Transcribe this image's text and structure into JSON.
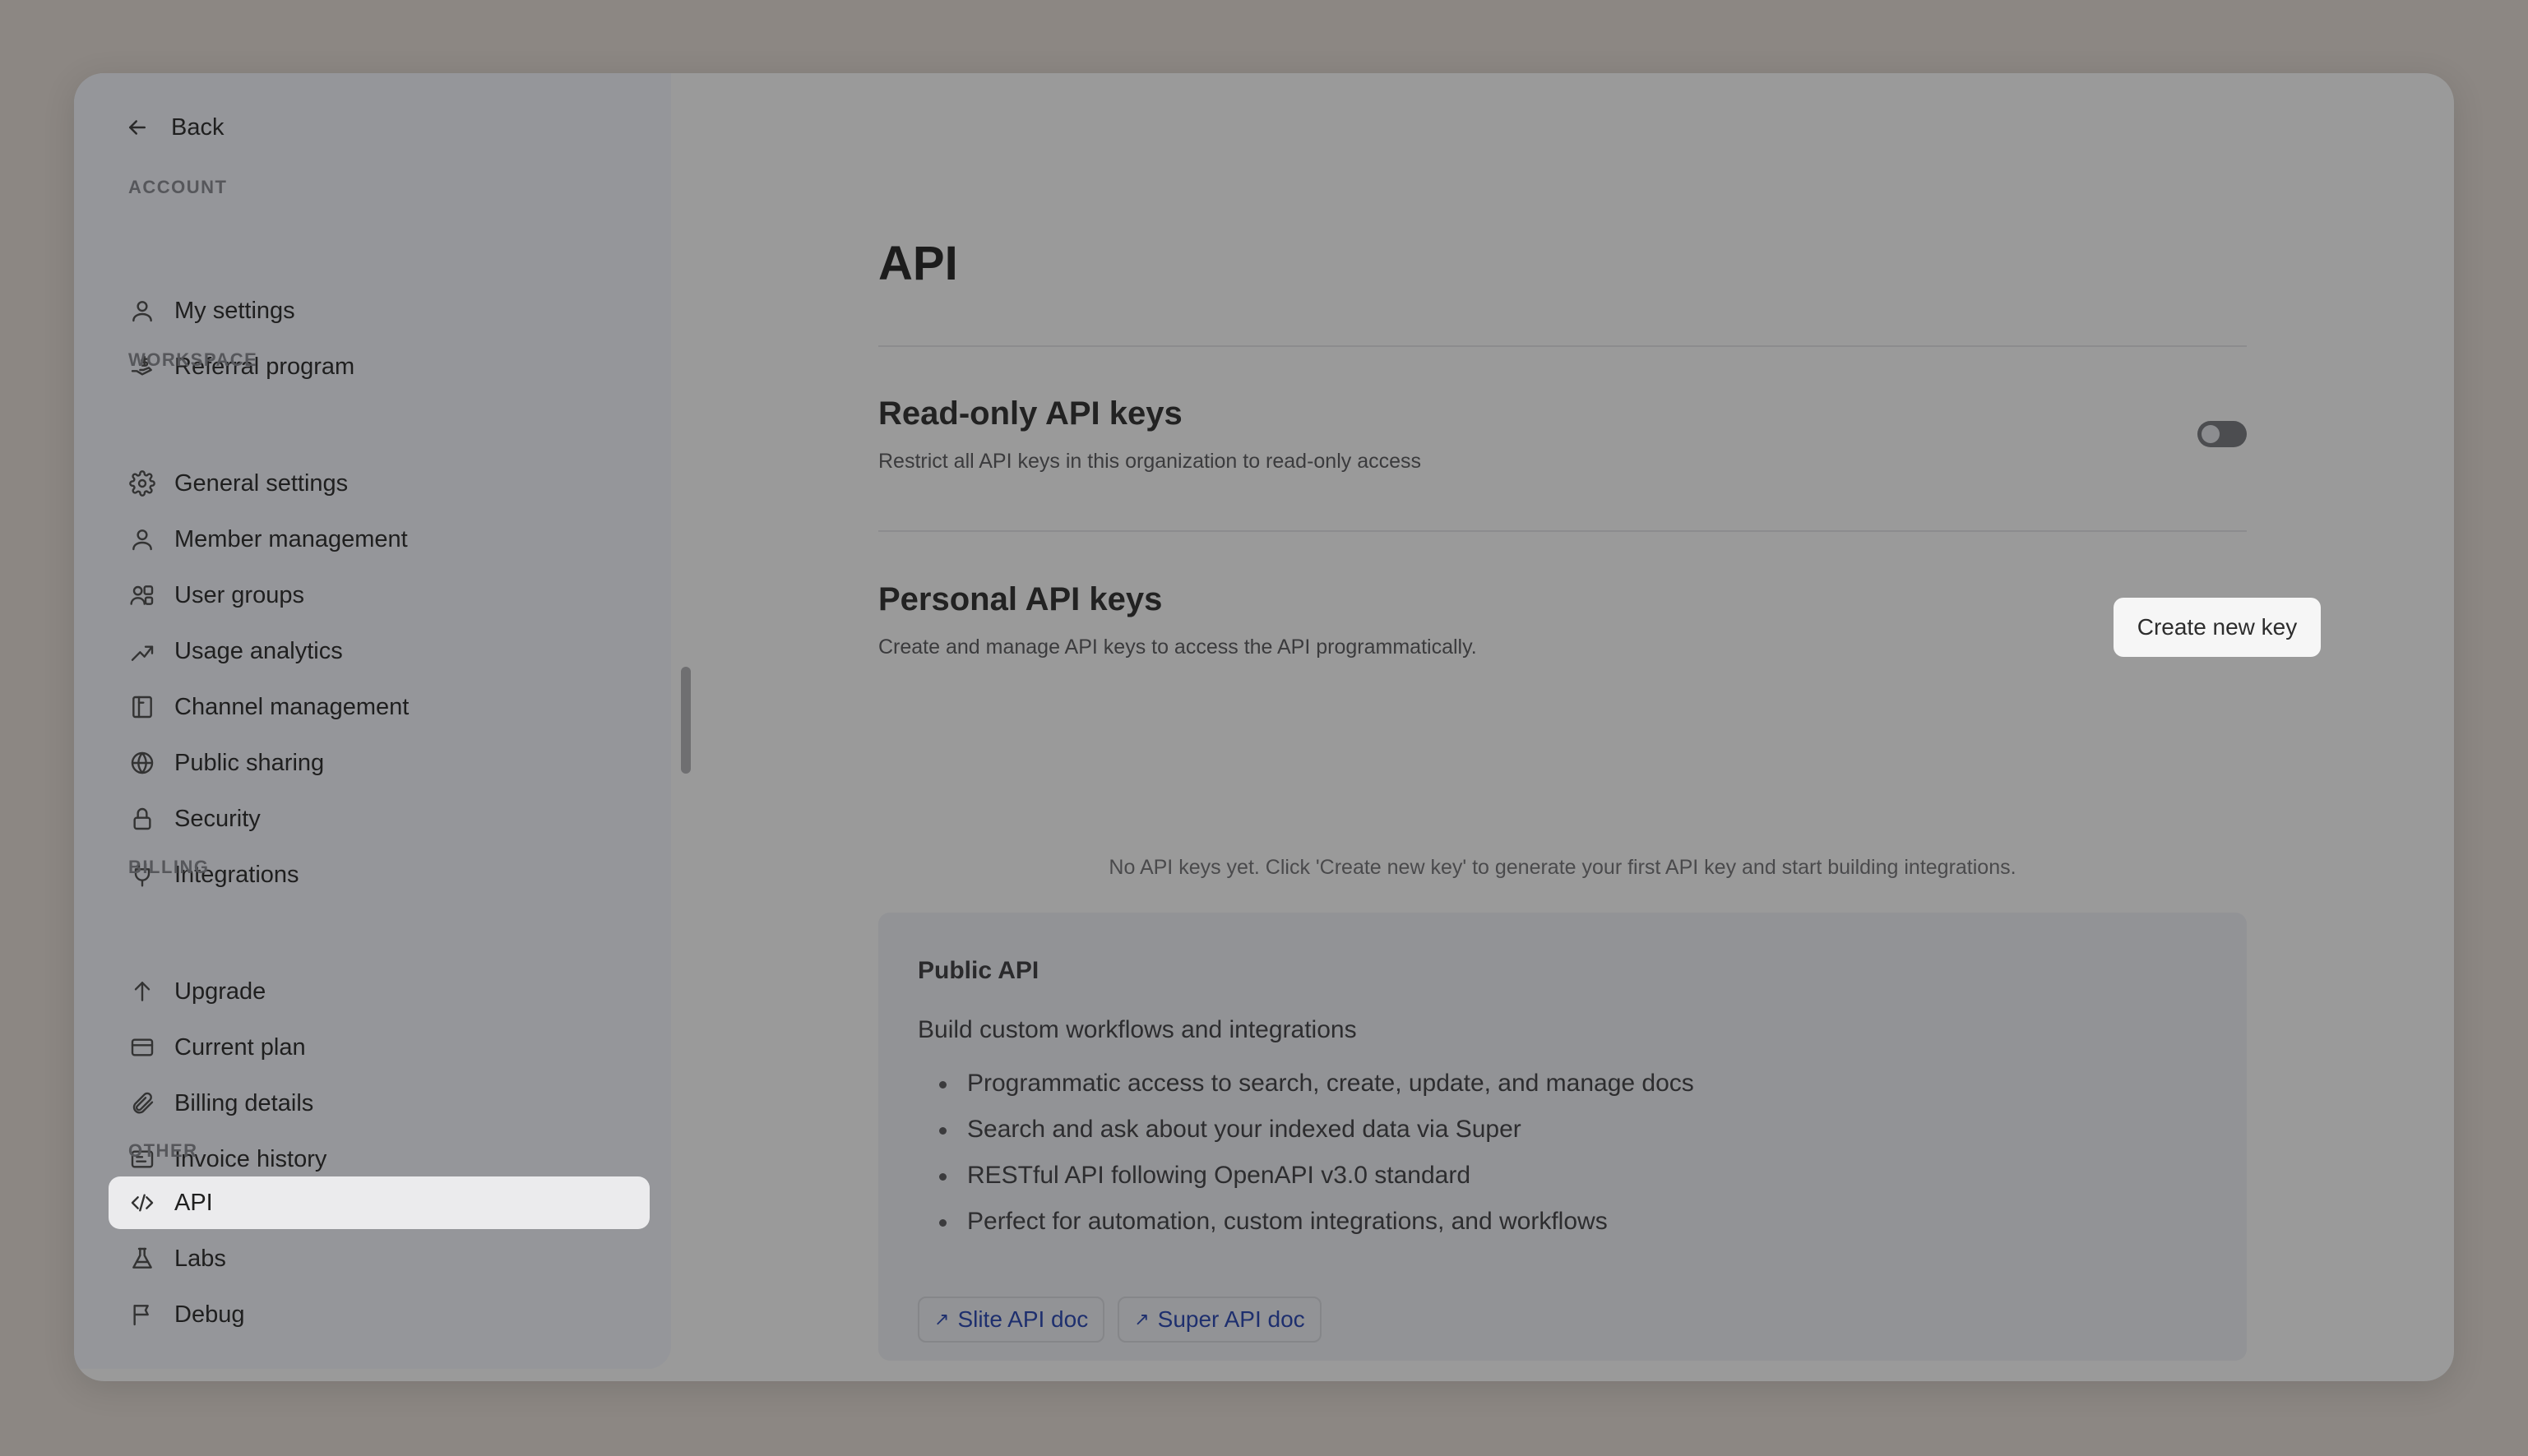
{
  "sidebar": {
    "back_label": "Back",
    "sections": {
      "account": "ACCOUNT",
      "workspace": "WORKSPACE",
      "billing": "BILLING",
      "other": "OTHER"
    },
    "items": [
      {
        "label": "My settings",
        "icon": "user-icon"
      },
      {
        "label": "Referral program",
        "icon": "hand-dollar-icon"
      },
      {
        "label": "General settings",
        "icon": "gear-icon"
      },
      {
        "label": "Member management",
        "icon": "user-icon"
      },
      {
        "label": "User groups",
        "icon": "users-icon"
      },
      {
        "label": "Usage analytics",
        "icon": "trending-up-icon"
      },
      {
        "label": "Channel management",
        "icon": "layout-icon"
      },
      {
        "label": "Public sharing",
        "icon": "globe-icon"
      },
      {
        "label": "Security",
        "icon": "lock-icon"
      },
      {
        "label": "Integrations",
        "icon": "plug-icon"
      },
      {
        "label": "Upgrade",
        "icon": "arrow-up-icon"
      },
      {
        "label": "Current plan",
        "icon": "credit-card-icon"
      },
      {
        "label": "Billing details",
        "icon": "paperclip-icon"
      },
      {
        "label": "Invoice history",
        "icon": "receipt-icon"
      },
      {
        "label": "API",
        "icon": "code-icon",
        "active": true
      },
      {
        "label": "Labs",
        "icon": "flask-icon"
      },
      {
        "label": "Debug",
        "icon": "flag-icon"
      }
    ]
  },
  "main": {
    "title": "API",
    "readonly": {
      "title": "Read-only API keys",
      "description": "Restrict all API keys in this organization to read-only access",
      "enabled": false
    },
    "personal": {
      "title": "Personal API keys",
      "description": "Create and manage API keys to access the API programmatically.",
      "create_button": "Create new key",
      "empty_message": "No API keys yet. Click 'Create new key' to generate your first API key and start building integrations."
    },
    "public_api": {
      "title": "Public API",
      "subtitle": "Build custom workflows and integrations",
      "bullets": [
        "Programmatic access to search, create, update, and manage docs",
        "Search and ask about your indexed data via Super",
        "RESTful API following OpenAPI v3.0 standard",
        "Perfect for automation, custom integrations, and workflows"
      ],
      "links": [
        {
          "label": "Slite API doc",
          "icon": "arrow-up-right-icon"
        },
        {
          "label": "Super API doc",
          "icon": "arrow-up-right-icon"
        }
      ]
    }
  },
  "colors": {
    "backdrop": "#8c8783",
    "active_item_bg": "#ebebed",
    "link_text": "#1e2f6e"
  }
}
